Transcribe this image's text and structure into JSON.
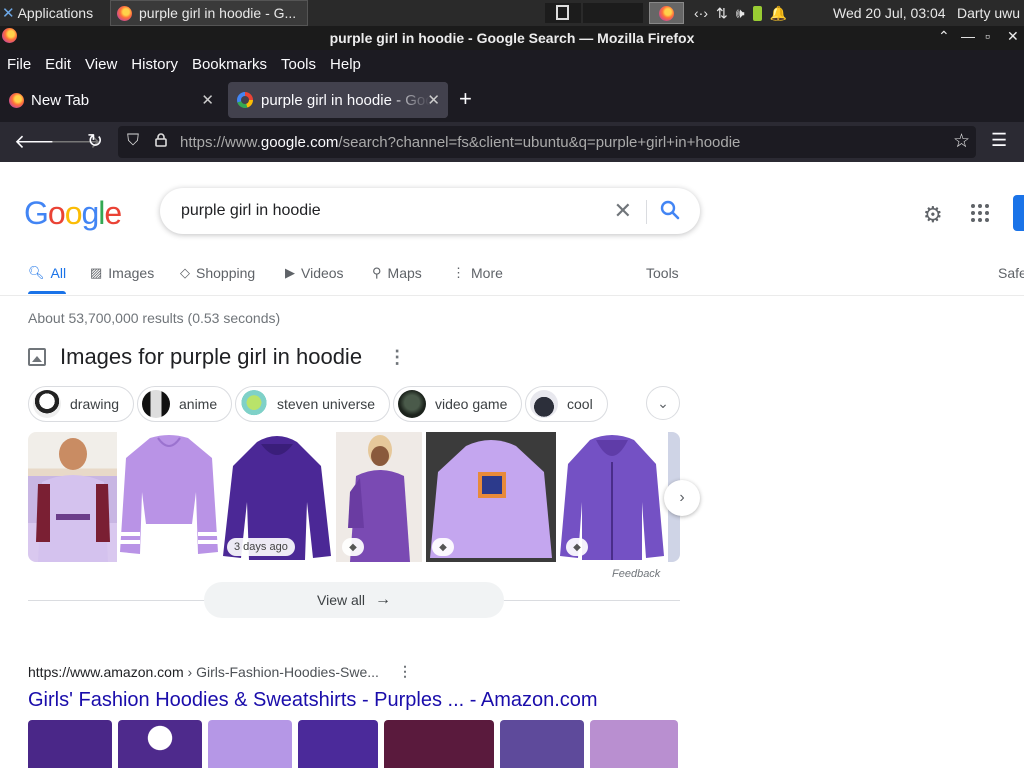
{
  "taskbar": {
    "applications_label": "Applications",
    "task_label": "purple girl in hoodie - G...",
    "clock": "Wed 20 Jul, 03:04",
    "user": "Darty uwu"
  },
  "window": {
    "title": "purple girl in hoodie - Google Search — Mozilla Firefox"
  },
  "menu": {
    "file": "File",
    "edit": "Edit",
    "view": "View",
    "history": "History",
    "bookmarks": "Bookmarks",
    "tools": "Tools",
    "help": "Help"
  },
  "tabs": [
    {
      "label": "New Tab"
    },
    {
      "label": "purple girl in hoodie - Google Search"
    }
  ],
  "url": {
    "prefix": "https://www.",
    "domain": "google.com",
    "path": "/search?channel=fs&client=ubuntu&q=purple+girl+in+hoodie"
  },
  "google": {
    "logo_letters": [
      "G",
      "o",
      "o",
      "g",
      "l",
      "e"
    ],
    "logo_colors": [
      "#4285F4",
      "#EA4335",
      "#FBBC05",
      "#4285F4",
      "#34A853",
      "#EA4335"
    ],
    "query": "purple girl in hoodie"
  },
  "nav_tabs": {
    "all": "All",
    "images": "Images",
    "shopping": "Shopping",
    "videos": "Videos",
    "maps": "Maps",
    "more": "More",
    "tools": "Tools",
    "safe": "Safe"
  },
  "stats": "About 53,700,000 results (0.53 seconds)",
  "images_section": {
    "heading": "Images for purple girl in hoodie",
    "chips": [
      "drawing",
      "anime",
      "steven universe",
      "video game",
      "cool"
    ],
    "badge": "3 days ago",
    "feedback": "Feedback",
    "view_all": "View all"
  },
  "result": {
    "cite_domain": "https://www.amazon.com",
    "cite_path": " › Girls-Fashion-Hoodies-Swe...",
    "title": "Girls' Fashion Hoodies & Sweatshirts - Purples ... - Amazon.com"
  },
  "colors": {
    "accent_blue": "#1a73e8",
    "link": "#1a0dab",
    "purple_main": "#6a3fb0",
    "lavender": "#c4a6ef"
  }
}
